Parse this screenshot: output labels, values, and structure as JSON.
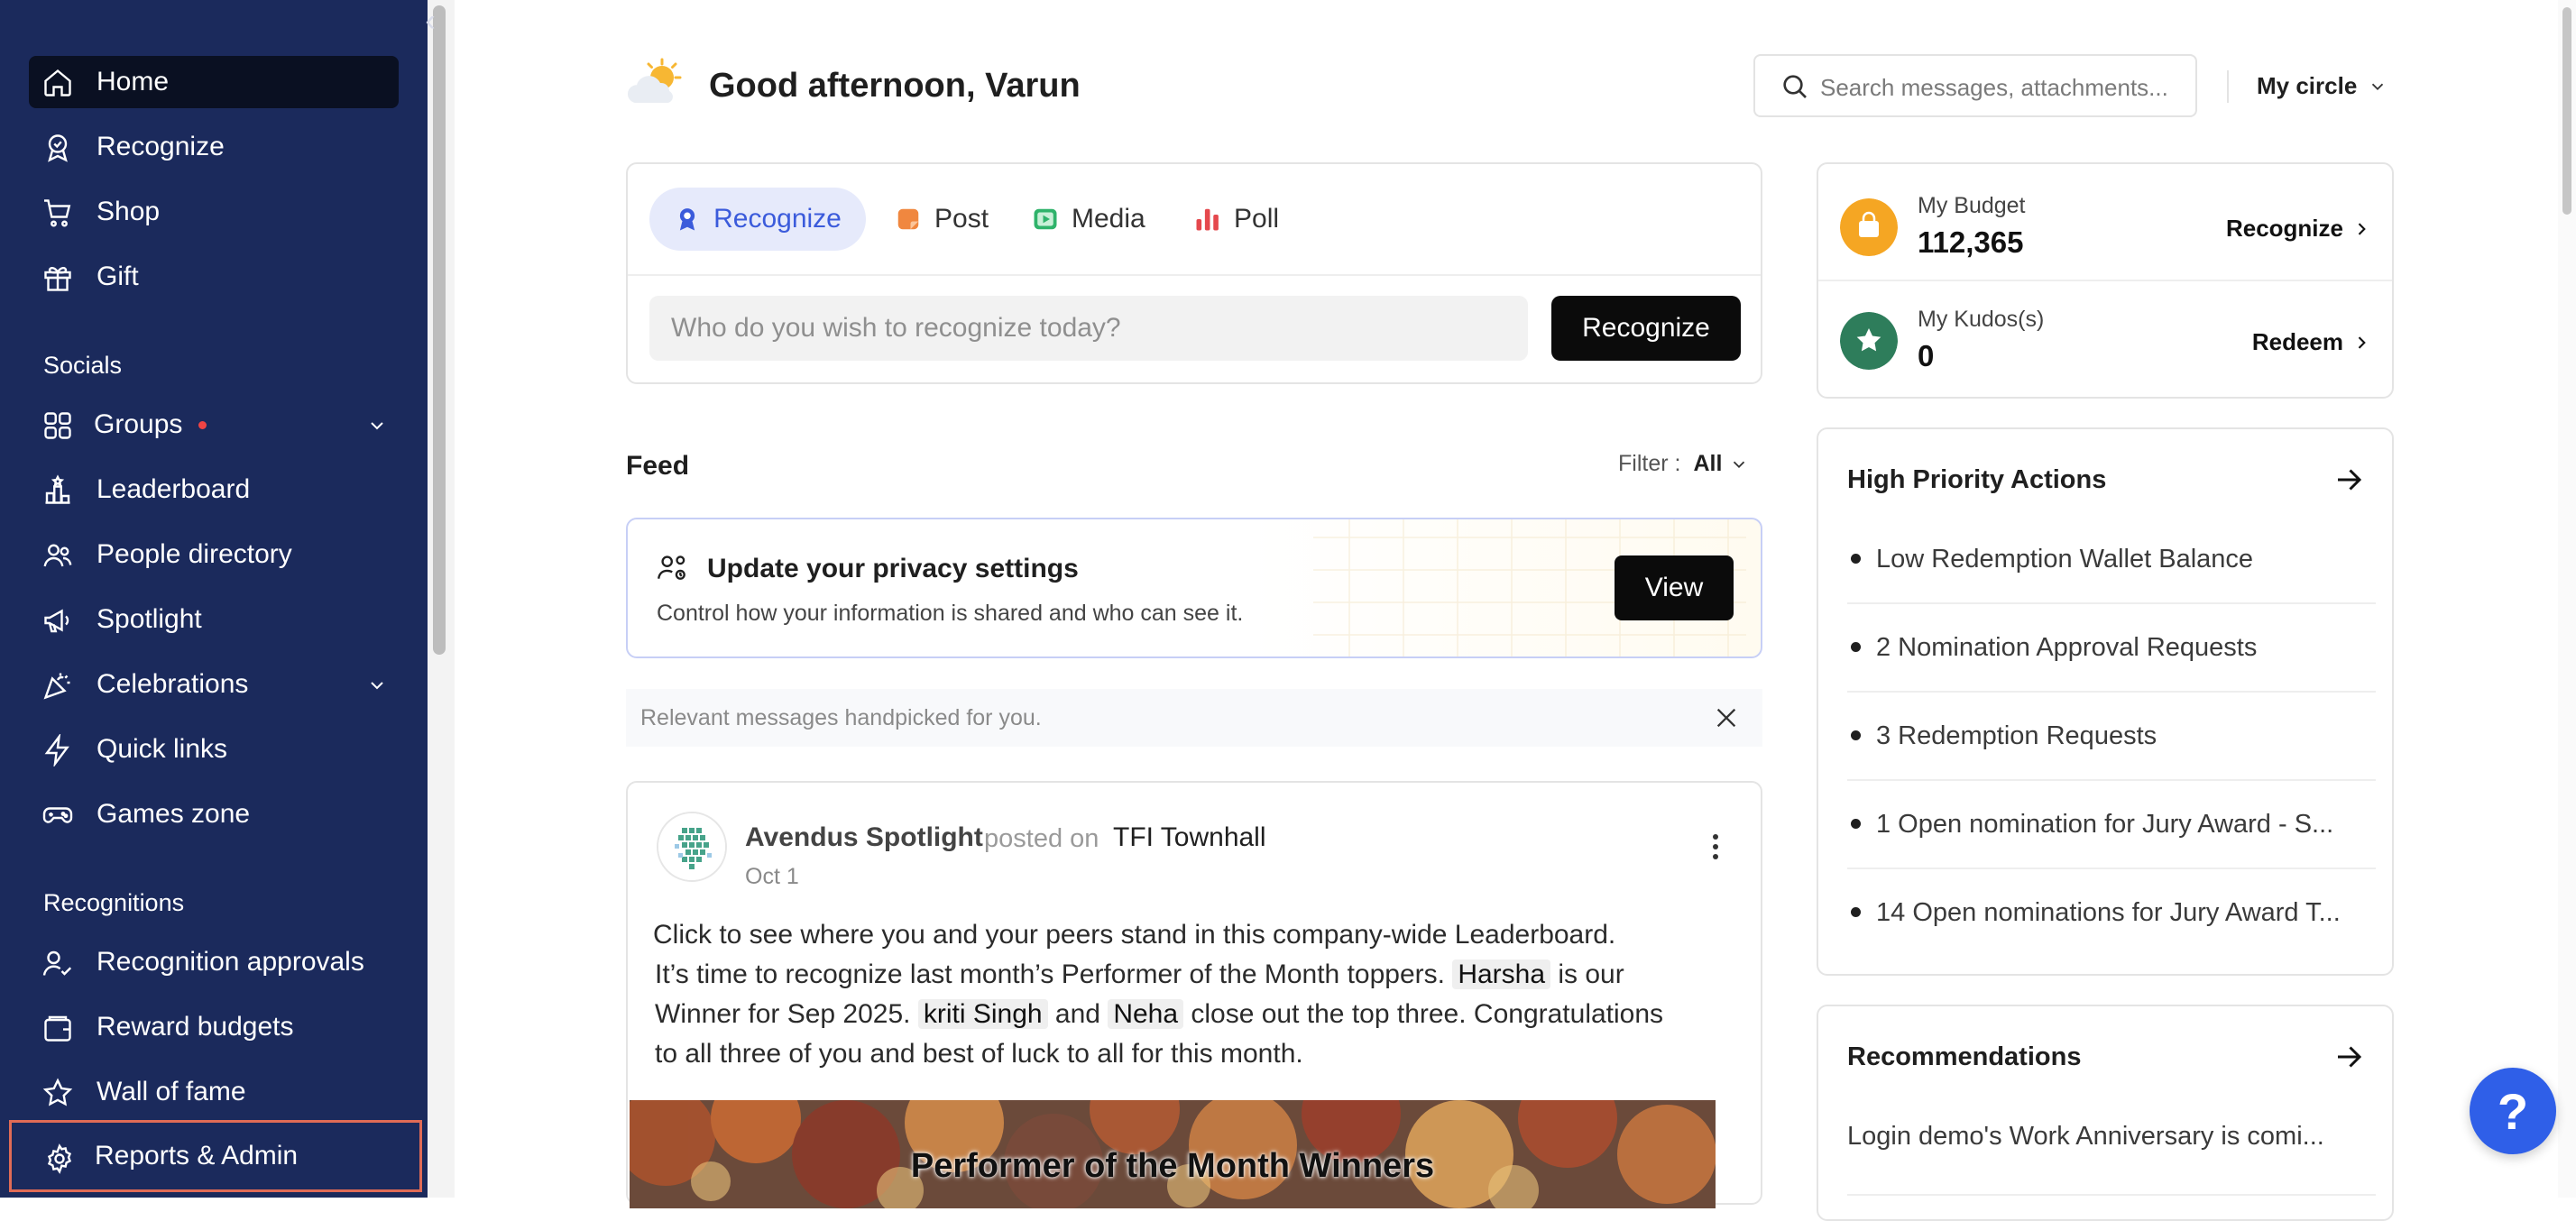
{
  "sidebar": {
    "nav": [
      {
        "label": "Home",
        "icon": "home-icon"
      },
      {
        "label": "Recognize",
        "icon": "ribbon-icon"
      },
      {
        "label": "Shop",
        "icon": "cart-icon"
      },
      {
        "label": "Gift",
        "icon": "gift-icon"
      }
    ],
    "socials_title": "Socials",
    "socials": [
      {
        "label": "Groups",
        "icon": "groups-icon"
      },
      {
        "label": "Leaderboard",
        "icon": "leaderboard-icon"
      },
      {
        "label": "People directory",
        "icon": "people-icon"
      },
      {
        "label": "Spotlight",
        "icon": "megaphone-icon"
      },
      {
        "label": "Celebrations",
        "icon": "party-icon"
      },
      {
        "label": "Quick links",
        "icon": "lightning-icon"
      },
      {
        "label": "Games zone",
        "icon": "gamepad-icon"
      }
    ],
    "recognitions_title": "Recognitions",
    "recognitions": [
      {
        "label": "Recognition approvals",
        "icon": "user-check-icon"
      },
      {
        "label": "Reward budgets",
        "icon": "wallet-icon"
      },
      {
        "label": "Wall of fame",
        "icon": "star-icon"
      }
    ],
    "reports_admin": "Reports & Admin"
  },
  "header": {
    "greeting": "Good afternoon, Varun",
    "search_placeholder": "Search messages, attachments...",
    "circle": "My circle"
  },
  "composer": {
    "tabs": [
      "Recognize",
      "Post",
      "Media",
      "Poll"
    ],
    "input_placeholder": "Who do you wish to recognize today?",
    "button": "Recognize"
  },
  "feed": {
    "title": "Feed",
    "filter_label": "Filter :",
    "filter_value": "All",
    "privacy": {
      "title": "Update your privacy settings",
      "description": "Control how your information is shared and who can see it.",
      "button": "View"
    },
    "relevant": "Relevant messages handpicked for you.",
    "post": {
      "author": "Avendus Spotlight",
      "posted_on": "posted on",
      "group": "TFI Townhall",
      "date": "Oct 1",
      "line1": "Click to see where you and your peers stand in this company-wide Leaderboard.",
      "line2_a": "It’s time to recognize last month’s Performer of the Month toppers.",
      "name1": "Harsha",
      "line2_b": "is our",
      "line3_a": "Winner for Sep 2025.",
      "name2": "kriti Singh",
      "and": "and",
      "name3": "Neha",
      "line3_b": "close out the top three. Congratulations",
      "line4": "to all three of you and best of luck to all for this month.",
      "image_title": "Performer of the Month Winners"
    }
  },
  "budget": {
    "my_budget_label": "My Budget",
    "my_budget_value": "112,365",
    "budget_action": "Recognize",
    "kudos_label": "My Kudos(s)",
    "kudos_value": "0",
    "kudos_action": "Redeem"
  },
  "hpa": {
    "title": "High Priority Actions",
    "items": [
      "Low Redemption Wallet Balance",
      "2 Nomination Approval Requests",
      "3 Redemption Requests",
      "1 Open nomination for Jury Award - S...",
      "14 Open nominations for Jury Award T..."
    ]
  },
  "reco": {
    "title": "Recommendations",
    "item": "Login demo's Work Anniversary is comi..."
  },
  "help": "?",
  "colors": {
    "sidebar": "#1b2a5c",
    "accent": "#3b5bdb",
    "help": "#2f5fe8",
    "highlight_border": "#e06b56"
  }
}
